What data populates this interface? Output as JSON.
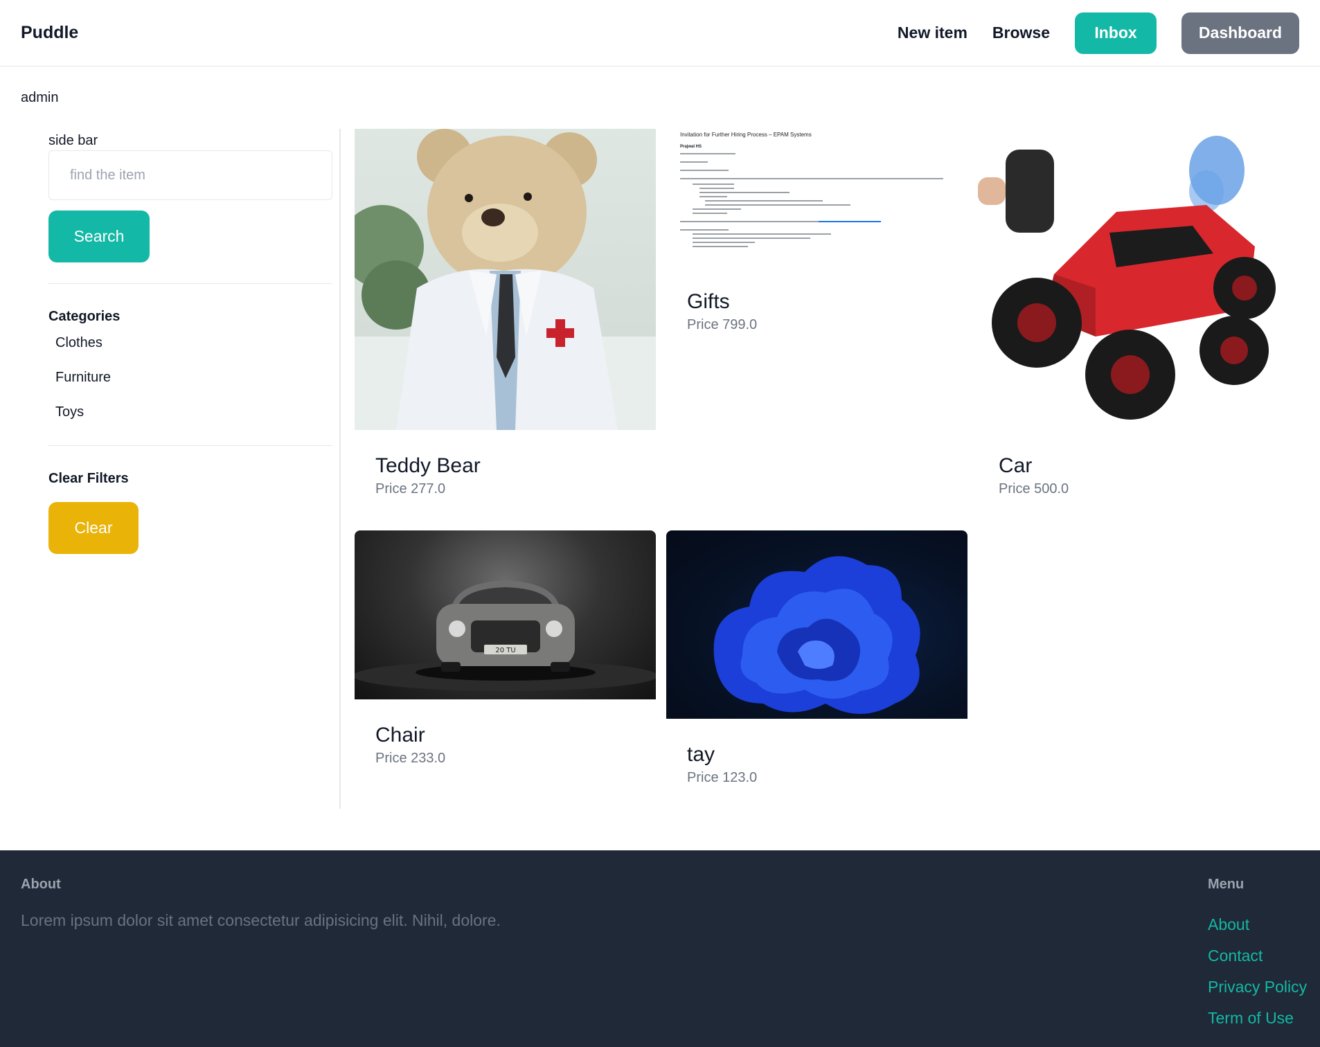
{
  "navbar": {
    "brand": "Puddle",
    "new_item": "New item",
    "browse": "Browse",
    "inbox": "Inbox",
    "dashboard": "Dashboard"
  },
  "user": {
    "name": "admin"
  },
  "sidebar": {
    "title": "side bar",
    "search_placeholder": "find the item",
    "search_button": "Search",
    "categories_title": "Categories",
    "categories": [
      "Clothes",
      "Furniture",
      "Toys"
    ],
    "clear_title": "Clear Filters",
    "clear_button": "Clear"
  },
  "items": [
    {
      "name": "Teddy Bear",
      "price": "Price 277.0"
    },
    {
      "name": "Gifts",
      "price": "Price 799.0"
    },
    {
      "name": "Car",
      "price": "Price 500.0"
    },
    {
      "name": "Chair",
      "price": "Price 233.0"
    },
    {
      "name": "tay",
      "price": "Price 123.0"
    }
  ],
  "gifts_image_text": {
    "subject": "Invitation for Further Hiring Process – EPAM Systems",
    "sender": "Prajwal HS"
  },
  "chair_image_text": {
    "plate": "20 TU"
  },
  "footer": {
    "about_title": "About",
    "about_text": "Lorem ipsum dolor sit amet consectetur adipisicing elit. Nihil, dolore.",
    "menu_title": "Menu",
    "links": [
      "About",
      "Contact",
      "Privacy Policy",
      "Term of Use"
    ]
  },
  "colors": {
    "teal": "#14b8a6",
    "gray_button": "#6b7280",
    "yellow": "#eab308",
    "footer_bg": "#1f2937"
  }
}
